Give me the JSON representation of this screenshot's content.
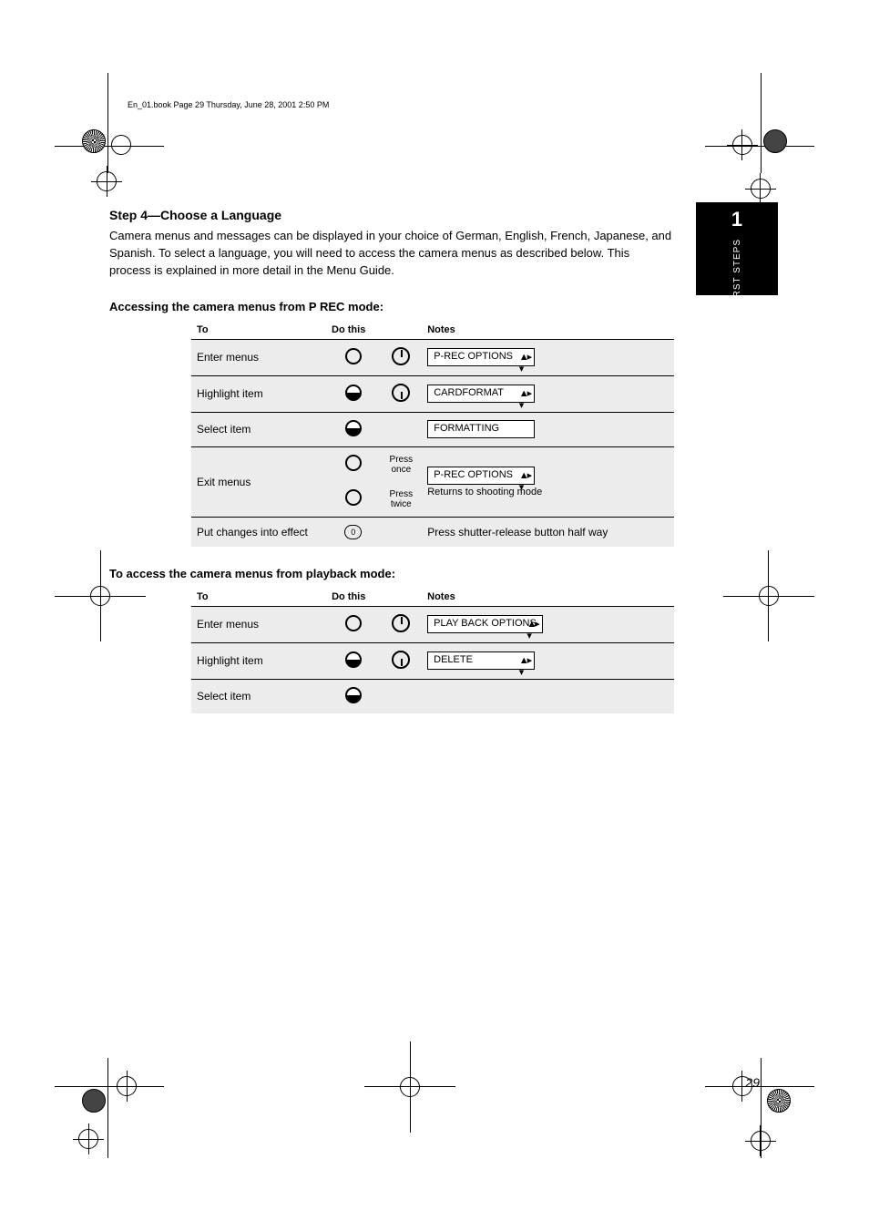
{
  "doc_header": "En_01.book  Page 29  Thursday, June 28, 2001  2:50 PM",
  "thumb": {
    "num": "1",
    "label": "FIRST STEPS"
  },
  "intro_heading": "Step 4—Choose a Language",
  "intro_text": "Camera menus and messages can be displayed in your choice of German, English, French, Japanese, and Spanish. To select a language, you will need to access the camera menus as described below. This process is explained in more detail in the Menu Guide.",
  "access_heading": "Accessing the camera menus from P REC mode:",
  "table1": {
    "headers": [
      "To",
      "Do this",
      "",
      "Notes"
    ],
    "rows": [
      {
        "to": "Enter menus",
        "icon1": "led-open",
        "icon2": "dial-up",
        "lcd": "P-REC OPTIONS",
        "note": ""
      },
      {
        "to": "Highlight item",
        "icon1": "led-half",
        "icon2": "dial-down",
        "lcd": "CARDFORMAT",
        "note": ""
      },
      {
        "to": "Select item",
        "icon1": "led-half",
        "icon2": "",
        "lcd_plain": "FORMATTING",
        "note": ""
      },
      {
        "to": "Exit menus",
        "icon1": "led-open",
        "sub1": "Press once",
        "icon3": "led-open",
        "sub2": "Press twice",
        "lcd": "P-REC OPTIONS",
        "note_tail": "Returns to shooting mode"
      },
      {
        "to": "Put changes into effect",
        "cmd": "0",
        "note": "Press shutter-release button half way"
      }
    ]
  },
  "access_heading2": "To access the camera menus from playback mode:",
  "table2": {
    "headers": [
      "To",
      "Do this",
      "",
      "Notes"
    ],
    "rows": [
      {
        "to": "Enter menus",
        "icon1": "led-open",
        "icon2": "dial-up",
        "lcd": "PLAY BACK  OPTIONS"
      },
      {
        "to": "Highlight item",
        "icon1": "led-half",
        "icon2": "dial-down",
        "lcd": "DELETE"
      },
      {
        "to": "Select item",
        "icon1": "led-half",
        "icon2": ""
      }
    ]
  },
  "page_number": "29"
}
